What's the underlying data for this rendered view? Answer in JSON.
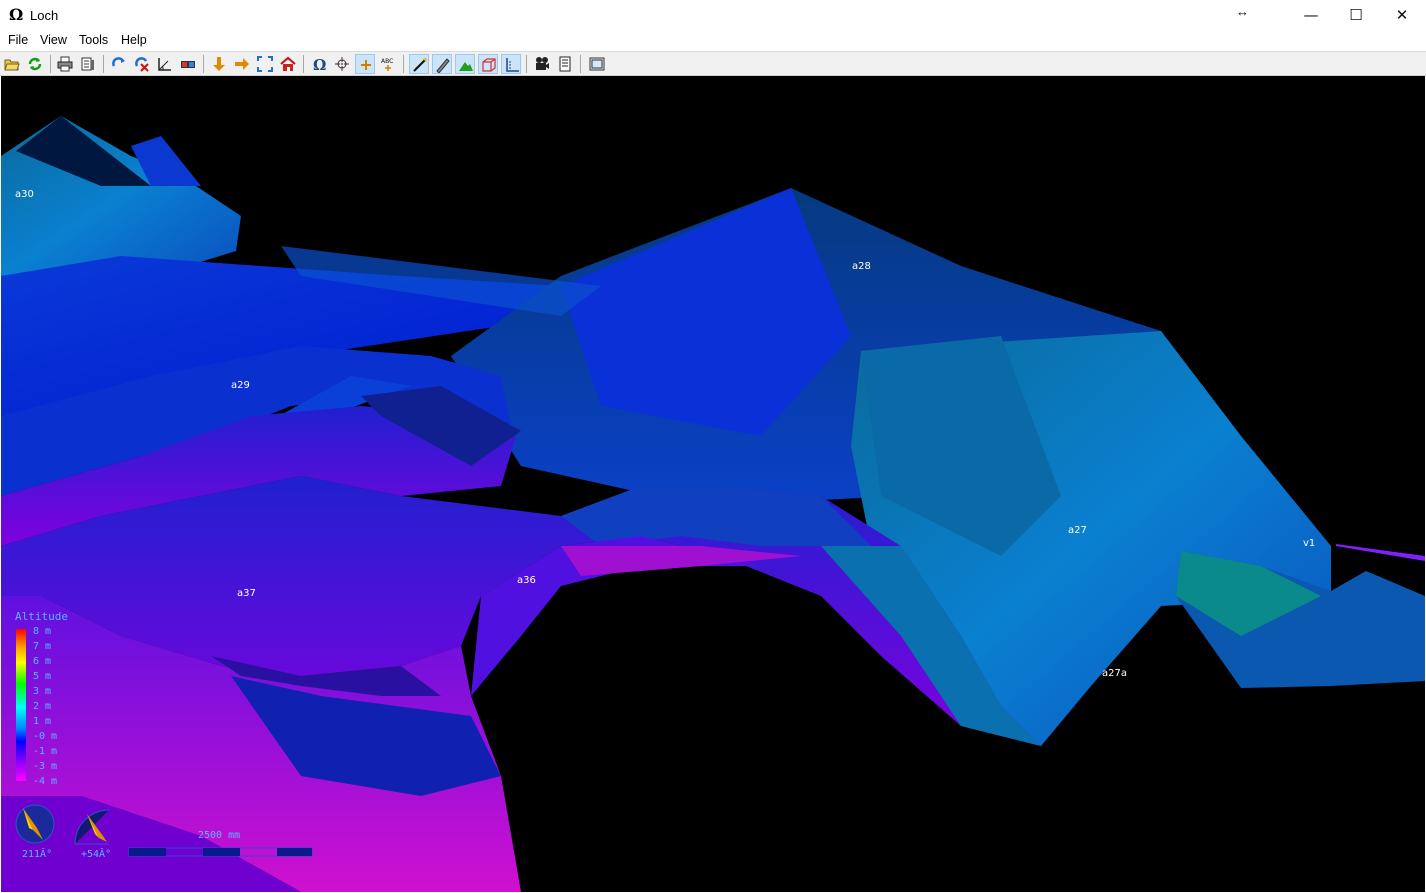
{
  "window": {
    "title": "Loch",
    "app_glyph": "Ω",
    "resize_glyph": "↔",
    "minimize_glyph": "—",
    "maximize_glyph": "☐",
    "close_glyph": "✕"
  },
  "menu": [
    "File",
    "View",
    "Tools",
    "Help"
  ],
  "toolbar": {
    "buttons": [
      {
        "name": "open-icon"
      },
      {
        "name": "reload-icon"
      },
      {
        "name": "print-icon"
      },
      {
        "name": "export-icon"
      },
      {
        "name": "rotate-icon"
      },
      {
        "name": "rotate-stop-icon"
      },
      {
        "name": "measure-icon"
      },
      {
        "name": "3d-glasses-icon"
      },
      {
        "name": "plan-view-icon"
      },
      {
        "name": "elevation-view-icon"
      },
      {
        "name": "zoom-extents-icon"
      },
      {
        "name": "home-icon"
      },
      {
        "name": "north-icon"
      },
      {
        "name": "crosshair-icon"
      },
      {
        "name": "surface-stations-icon",
        "active": true
      },
      {
        "name": "station-names-icon"
      },
      {
        "name": "centreline-icon",
        "active": true
      },
      {
        "name": "walls-icon",
        "active": true
      },
      {
        "name": "surface-icon",
        "active": true
      },
      {
        "name": "box-icon",
        "active": true
      },
      {
        "name": "depth-bar-icon",
        "active": true
      },
      {
        "name": "animation-icon"
      },
      {
        "name": "info-panel-icon"
      },
      {
        "name": "fullscreen-icon"
      }
    ]
  },
  "stations": [
    {
      "label": "a30"
    },
    {
      "label": "a28"
    },
    {
      "label": "a29"
    },
    {
      "label": "a27"
    },
    {
      "label": "v1"
    },
    {
      "label": "a37"
    },
    {
      "label": "a36"
    },
    {
      "label": "a27a"
    }
  ],
  "legend": {
    "title": "Altitude",
    "values": [
      "8 m",
      "7 m",
      "6 m",
      "5 m",
      "3 m",
      "2 m",
      "1 m",
      "-0 m",
      "-1 m",
      "-3 m",
      "-4 m"
    ]
  },
  "hud": {
    "compass_bearing": "211Â°",
    "tilt": "+54Â°",
    "scale_label": "2500 mm"
  }
}
